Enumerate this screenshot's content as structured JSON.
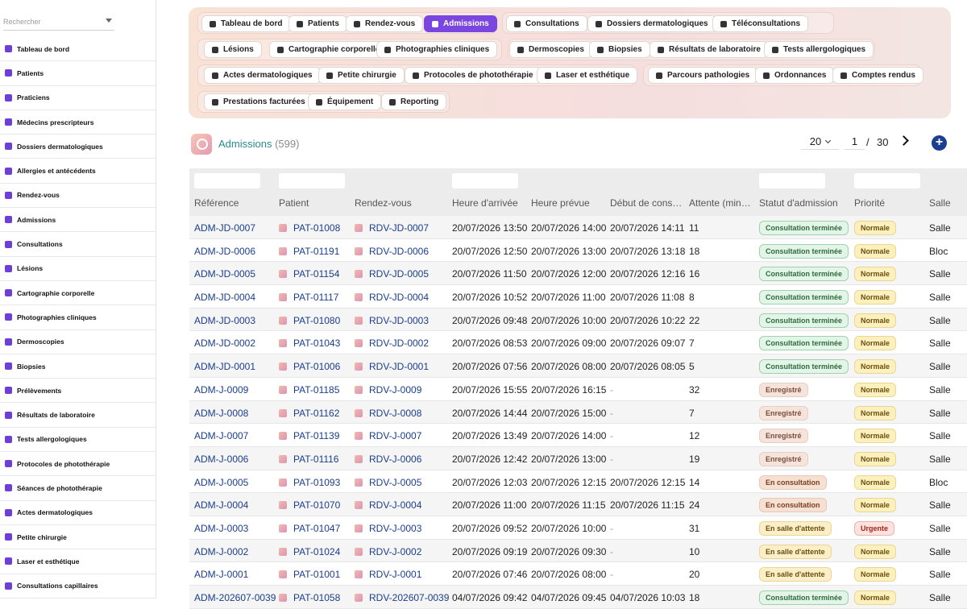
{
  "search": {
    "placeholder": "Rechercher"
  },
  "sidebar": {
    "items": [
      {
        "label": "Tableau de bord",
        "icon": "dashboard-icon"
      },
      {
        "label": "Patients",
        "icon": "person-icon"
      },
      {
        "label": "Praticiens",
        "icon": "person-icon"
      },
      {
        "label": "Médecins prescripteurs",
        "icon": "stethoscope-icon"
      },
      {
        "label": "Dossiers dermatologiques",
        "icon": "folder-icon"
      },
      {
        "label": "Allergies et antécédents",
        "icon": "warning-icon"
      },
      {
        "label": "Rendez-vous",
        "icon": "calendar-icon"
      },
      {
        "label": "Admissions",
        "icon": "clipboard-icon"
      },
      {
        "label": "Consultations",
        "icon": "clipboard-icon"
      },
      {
        "label": "Lésions",
        "icon": "circle-icon"
      },
      {
        "label": "Cartographie corporelle",
        "icon": "body-icon"
      },
      {
        "label": "Photographies cliniques",
        "icon": "camera-icon"
      },
      {
        "label": "Dermoscopies",
        "icon": "magnifier-icon"
      },
      {
        "label": "Biopsies",
        "icon": "scissors-icon"
      },
      {
        "label": "Prélèvements",
        "icon": "pipette-icon"
      },
      {
        "label": "Résultats de laboratoire",
        "icon": "document-icon"
      },
      {
        "label": "Tests allergologiques",
        "icon": "tests-icon"
      },
      {
        "label": "Protocoles de photothérapie",
        "icon": "sun-icon"
      },
      {
        "label": "Séances de photothérapie",
        "icon": "bulb-icon"
      },
      {
        "label": "Actes dermatologiques",
        "icon": "procedure-icon"
      },
      {
        "label": "Petite chirurgie",
        "icon": "bed-icon"
      },
      {
        "label": "Laser et esthétique",
        "icon": "bolt-icon"
      },
      {
        "label": "Consultations capillaires",
        "icon": "hair-icon"
      }
    ]
  },
  "nav": {
    "buttons": [
      {
        "label": "Tableau de bord",
        "name": "nav-tableau-de-bord",
        "active": false
      },
      {
        "label": "Patients",
        "name": "nav-patients",
        "active": false
      },
      {
        "label": "Rendez-vous",
        "name": "nav-rendez-vous",
        "active": false
      },
      {
        "label": "Admissions",
        "name": "nav-admissions",
        "active": true
      },
      {
        "label": "Consultations",
        "name": "nav-consultations",
        "active": false
      },
      {
        "label": "Dossiers dermatologiques",
        "name": "nav-dossiers-dermatologiques",
        "active": false
      },
      {
        "label": "Téléconsultations",
        "name": "nav-teleconsultations",
        "active": false
      },
      {
        "label": "Lésions",
        "name": "nav-lesions",
        "active": false
      },
      {
        "label": "Cartographie corporelle",
        "name": "nav-cartographie-corporelle",
        "active": false
      },
      {
        "label": "Photographies cliniques",
        "name": "nav-photographies-cliniques",
        "active": false
      },
      {
        "label": "Dermoscopies",
        "name": "nav-dermoscopies",
        "active": false
      },
      {
        "label": "Biopsies",
        "name": "nav-biopsies",
        "active": false
      },
      {
        "label": "Résultats de laboratoire",
        "name": "nav-resultats-de-laboratoire",
        "active": false
      },
      {
        "label": "Tests allergologiques",
        "name": "nav-tests-allergologiques",
        "active": false
      },
      {
        "label": "Actes dermatologiques",
        "name": "nav-actes-dermatologiques",
        "active": false
      },
      {
        "label": "Petite chirurgie",
        "name": "nav-petite-chirurgie",
        "active": false
      },
      {
        "label": "Protocoles de photothérapie",
        "name": "nav-protocoles-de-phototherapie",
        "active": false
      },
      {
        "label": "Laser et esthétique",
        "name": "nav-laser-et-esthetique",
        "active": false
      },
      {
        "label": "Parcours pathologies",
        "name": "nav-parcours-pathologies",
        "active": false
      },
      {
        "label": "Ordonnances",
        "name": "nav-ordonnances",
        "active": false
      },
      {
        "label": "Comptes rendus",
        "name": "nav-comptes-rendus",
        "active": false
      },
      {
        "label": "Prestations facturées",
        "name": "nav-prestations-facturees",
        "active": false
      },
      {
        "label": "Équipement",
        "name": "nav-equipement",
        "active": false
      },
      {
        "label": "Reporting",
        "name": "nav-reporting",
        "active": false
      }
    ]
  },
  "header": {
    "title": "Admissions",
    "count": "(599)"
  },
  "pager": {
    "size": "20",
    "page": "1",
    "separator": "/",
    "total": "30"
  },
  "add_button": "+",
  "table": {
    "columns": [
      "Référence",
      "Patient",
      "Rendez-vous",
      "Heure d'arrivée",
      "Heure prévue",
      "Début de cons…",
      "Attente (min…",
      "Statut d'admission",
      "Priorité",
      "Salle"
    ],
    "rows": [
      [
        "ADM-JD-0007",
        "PAT-01008",
        "RDV-JD-0007",
        "20/07/2026 13:50",
        "20/07/2026 14:00",
        "20/07/2026 14:11",
        "11",
        "Consultation terminée",
        "Normale",
        "Salle"
      ],
      [
        "ADM-JD-0006",
        "PAT-01191",
        "RDV-JD-0006",
        "20/07/2026 12:50",
        "20/07/2026 13:00",
        "20/07/2026 13:18",
        "18",
        "Consultation terminée",
        "Normale",
        "Bloc"
      ],
      [
        "ADM-JD-0005",
        "PAT-01154",
        "RDV-JD-0005",
        "20/07/2026 11:50",
        "20/07/2026 12:00",
        "20/07/2026 12:16",
        "16",
        "Consultation terminée",
        "Normale",
        "Salle"
      ],
      [
        "ADM-JD-0004",
        "PAT-01117",
        "RDV-JD-0004",
        "20/07/2026 10:52",
        "20/07/2026 11:00",
        "20/07/2026 11:08",
        "8",
        "Consultation terminée",
        "Normale",
        "Salle"
      ],
      [
        "ADM-JD-0003",
        "PAT-01080",
        "RDV-JD-0003",
        "20/07/2026 09:48",
        "20/07/2026 10:00",
        "20/07/2026 10:22",
        "22",
        "Consultation terminée",
        "Normale",
        "Salle"
      ],
      [
        "ADM-JD-0002",
        "PAT-01043",
        "RDV-JD-0002",
        "20/07/2026 08:53",
        "20/07/2026 09:00",
        "20/07/2026 09:07",
        "7",
        "Consultation terminée",
        "Normale",
        "Salle"
      ],
      [
        "ADM-JD-0001",
        "PAT-01006",
        "RDV-JD-0001",
        "20/07/2026 07:56",
        "20/07/2026 08:00",
        "20/07/2026 08:05",
        "5",
        "Consultation terminée",
        "Normale",
        "Salle"
      ],
      [
        "ADM-J-0009",
        "PAT-01185",
        "RDV-J-0009",
        "20/07/2026 15:55",
        "20/07/2026 16:15",
        "-",
        "32",
        "Enregistré",
        "Normale",
        "Salle"
      ],
      [
        "ADM-J-0008",
        "PAT-01162",
        "RDV-J-0008",
        "20/07/2026 14:44",
        "20/07/2026 15:00",
        "-",
        "7",
        "Enregistré",
        "Normale",
        "Salle"
      ],
      [
        "ADM-J-0007",
        "PAT-01139",
        "RDV-J-0007",
        "20/07/2026 13:49",
        "20/07/2026 14:00",
        "-",
        "12",
        "Enregistré",
        "Normale",
        "Salle"
      ],
      [
        "ADM-J-0006",
        "PAT-01116",
        "RDV-J-0006",
        "20/07/2026 12:42",
        "20/07/2026 13:00",
        "-",
        "19",
        "Enregistré",
        "Normale",
        "Salle"
      ],
      [
        "ADM-J-0005",
        "PAT-01093",
        "RDV-J-0005",
        "20/07/2026 12:03",
        "20/07/2026 12:15",
        "20/07/2026 12:15",
        "14",
        "En consultation",
        "Normale",
        "Bloc"
      ],
      [
        "ADM-J-0004",
        "PAT-01070",
        "RDV-J-0004",
        "20/07/2026 11:00",
        "20/07/2026 11:15",
        "20/07/2026 11:15",
        "24",
        "En consultation",
        "Normale",
        "Salle"
      ],
      [
        "ADM-J-0003",
        "PAT-01047",
        "RDV-J-0003",
        "20/07/2026 09:52",
        "20/07/2026 10:00",
        "-",
        "31",
        "En salle d'attente",
        "Urgente",
        "Salle"
      ],
      [
        "ADM-J-0002",
        "PAT-01024",
        "RDV-J-0002",
        "20/07/2026 09:19",
        "20/07/2026 09:30",
        "-",
        "10",
        "En salle d'attente",
        "Normale",
        "Salle"
      ],
      [
        "ADM-J-0001",
        "PAT-01001",
        "RDV-J-0001",
        "20/07/2026 07:46",
        "20/07/2026 08:00",
        "-",
        "20",
        "En salle d'attente",
        "Normale",
        "Salle"
      ],
      [
        "ADM-202607-0039",
        "PAT-01058",
        "RDV-202607-0039",
        "04/07/2026 09:42",
        "04/07/2026 09:45",
        "04/07/2026 10:03",
        "18",
        "Consultation terminée",
        "Normale",
        "Salle"
      ]
    ]
  },
  "colors": {
    "accent": "#7b46e0",
    "title": "#2b8a91",
    "link": "#1a3e8c",
    "status_done_bg": "#e3f5e8",
    "status_done_fg": "#2f6b3c",
    "status_done_border": "#9ed3a9",
    "status_registered_bg": "#f6e4dc",
    "status_registered_fg": "#7a4c3a",
    "status_consult_bg": "#f6e0d2",
    "status_consult_fg": "#7a3f21",
    "status_waiting_bg": "#fbefc9",
    "status_waiting_fg": "#6b4e0a",
    "prio_normal_bg": "#fdf0bf",
    "prio_normal_fg": "#6b4e0a",
    "prio_urgent_bg": "#fde2de",
    "prio_urgent_fg": "#a8231a"
  }
}
